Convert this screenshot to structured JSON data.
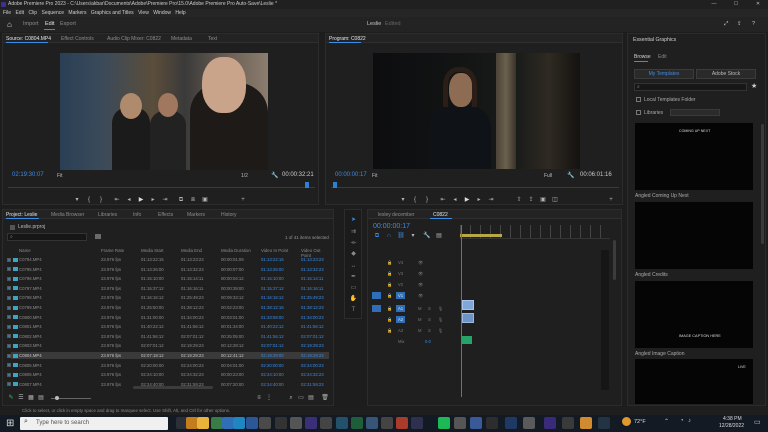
{
  "app": {
    "title": "Adobe Premiere Pro 2023 - C:\\Users\\akbar\\Documents\\Adobe\\Premiere Pro\\15.0\\Adobe Premiere Pro Auto-Save\\Leslie *"
  },
  "menu": [
    "File",
    "Edit",
    "Clip",
    "Sequence",
    "Markers",
    "Graphics and Titles",
    "View",
    "Window",
    "Help"
  ],
  "workspace": {
    "tabs": [
      "Import",
      "Edit",
      "Export"
    ],
    "project_name": "Leslie",
    "edit_status": "Edited"
  },
  "source": {
    "tabs": [
      "Source: C0804.MP4",
      "Effect Controls",
      "Audio Clip Mixer: C0822",
      "Metadata",
      "Text"
    ],
    "timecode_in": "02:19:30:07",
    "fit": "Fit",
    "ratio": "1/2",
    "timecode_out": "00:00:32:21"
  },
  "program": {
    "tab": "Program: C0822",
    "timecode_in": "00:00:00:17",
    "fit": "Fit",
    "ratio": "Full",
    "timecode_out": "00:06:01:16"
  },
  "project": {
    "tabs": [
      "Project: Leslie",
      "Media Browser",
      "Libraries",
      "Info",
      "Effects",
      "Markers",
      "History"
    ],
    "file": "Leslie.prproj",
    "selection_info": "1 of 41 items selected",
    "columns": [
      "Name",
      "Frame Rate",
      "Media Start",
      "Media End",
      "Media Duration",
      "Video In Point",
      "Video Out Point"
    ],
    "rows": [
      [
        "C0794.MP4",
        "23.976 fps",
        "01:13:22:15",
        "01:13:23:23",
        "00:00:01:09",
        "01:13:22:15",
        "01:13:23:23"
      ],
      [
        "C0795.MP4",
        "23.976 fps",
        "01:13:26:00",
        "01:13:32:23",
        "00:00:07:00",
        "01:13:26:00",
        "01:13:32:23"
      ],
      [
        "C0796.MP4",
        "23.976 fps",
        "01:15:10:00",
        "01:15:14:11",
        "00:00:04:12",
        "01:15:10:00",
        "01:15:14:11"
      ],
      [
        "C0797.MP4",
        "23.976 fps",
        "01:15:37:12",
        "01:16:16:11",
        "00:00:39:00",
        "01:15:37:12",
        "01:16:16:11"
      ],
      [
        "C0798.MP4",
        "23.976 fps",
        "01:16:16:12",
        "01:25:49:23",
        "00:09:33:12",
        "01:16:16:12",
        "01:25:49:23"
      ],
      [
        "C0799.MP4",
        "23.976 fps",
        "01:25:50:00",
        "01:28:12:23",
        "00:02:23:00",
        "01:28:12:16",
        "01:28:12:23"
      ],
      [
        "C0800.MP4",
        "23.976 fps",
        "01:31:00:00",
        "01:34:00:23",
        "00:03:01:00",
        "01:33:59:00",
        "01:34:00:23"
      ],
      [
        "C0801.MP4",
        "23.976 fps",
        "01:40:22:12",
        "01:41:56:12",
        "00:01:34:00",
        "01:40:22:12",
        "01:41:56:12"
      ],
      [
        "C0802.MP4",
        "23.976 fps",
        "01:41:56:12",
        "02:07:01:12",
        "00:25:05:00",
        "01:41:56:12",
        "02:07:01:12"
      ],
      [
        "C0803.MP4",
        "23.976 fps",
        "02:07:01:12",
        "02:19:29:23",
        "00:12:28:12",
        "02:07:01:12",
        "02:19:29:23"
      ],
      [
        "C0804.MP4",
        "23.976 fps",
        "02:07:18:12",
        "02:19:29:23",
        "00:12:41:12",
        "02:19:29:00",
        "02:19:29:23"
      ],
      [
        "C0805.MP4",
        "23.976 fps",
        "02:20:00:00",
        "02:24:00:23",
        "00:04:01:00",
        "02:20:00:00",
        "02:24:00:23"
      ],
      [
        "C0806.MP4",
        "23.976 fps",
        "02:24:10:00",
        "02:24:32:23",
        "00:00:23:00",
        "02:24:10:00",
        "02:24:32:23"
      ],
      [
        "C0807.MP4",
        "23.976 fps",
        "02:24:40:00",
        "02:31:59:23",
        "00:07:20:00",
        "02:24:40:00",
        "02:31:59:23"
      ]
    ],
    "selected_row": 10
  },
  "timeline": {
    "tabs": [
      "lesley december",
      "C0822"
    ],
    "timecode": "00:00:00:17",
    "tracks_video": [
      "V4",
      "V3",
      "V2",
      "V1"
    ],
    "tracks_audio": [
      "A1",
      "A2",
      "A3"
    ],
    "mix_label": "Mix",
    "mix_value": "0.0"
  },
  "essential_graphics": {
    "title": "Essential Graphics",
    "tabs": [
      "Browse",
      "Edit"
    ],
    "sources": [
      "My Templates",
      "Adobe Stock"
    ],
    "local_templates": "Local Templates Folder",
    "libraries": "Libraries",
    "templates": [
      {
        "name": "Angled Coming Up Next",
        "preview": "COMING UP NEXT"
      },
      {
        "name": "Angled Credits",
        "preview": ""
      },
      {
        "name": "Angled Image Caption",
        "preview": "IMAGE CAPTION HERE"
      },
      {
        "name": "",
        "preview": "LIVE"
      }
    ]
  },
  "status": {
    "hint": "Click to select, or click in empty space and drag to marquee select. Use Shift, Alt, and Ctrl for other options."
  },
  "taskbar": {
    "search_placeholder": "Type here to search",
    "temperature": "72°F",
    "time": "4:38 PM",
    "date": "12/28/2022"
  },
  "colors": {
    "accent": "#3b8ce6",
    "playhead": "#2f7fd6",
    "clip_video": "#7fa7d8",
    "clip_audio": "#27a36a"
  }
}
